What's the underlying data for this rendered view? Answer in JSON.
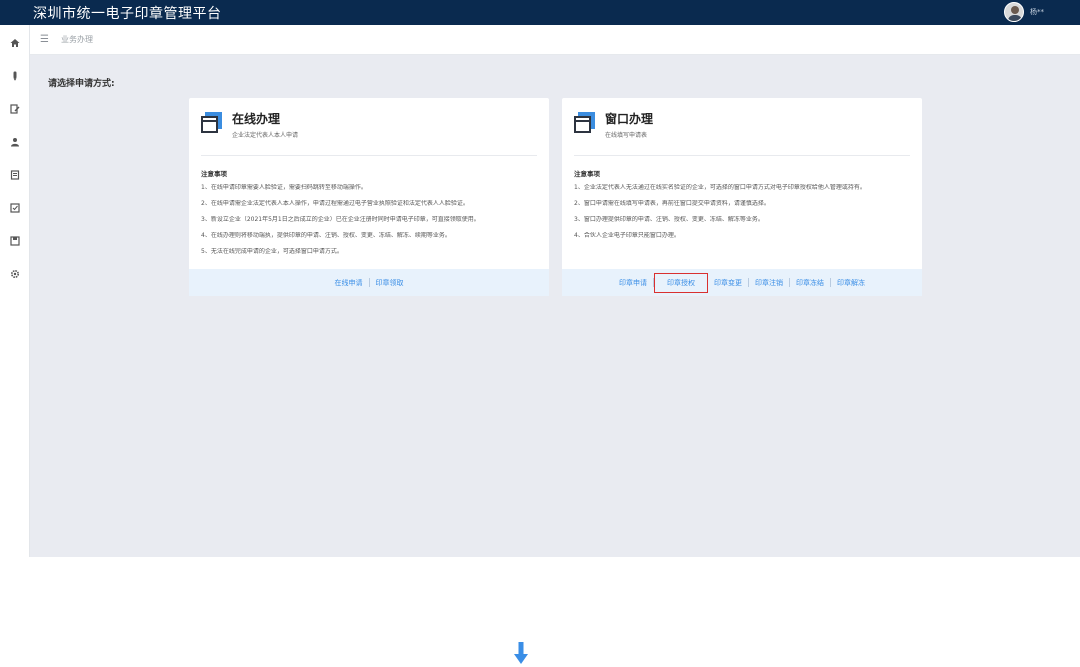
{
  "app": {
    "title": "深圳市统一电子印章管理平台",
    "user_name": "杨**"
  },
  "sidebar": {
    "icons": [
      "home-icon",
      "pen-icon",
      "edit-icon",
      "user-icon",
      "book-icon",
      "checklist-icon",
      "save-icon",
      "gear-icon"
    ]
  },
  "breadcrumb": {
    "toggle": "☰",
    "current": "业务办理"
  },
  "page": {
    "choose_label": "请选择申请方式:"
  },
  "online": {
    "title": "在线办理",
    "subtitle": "企业法定代表人本人申请",
    "notes_title": "注意事项",
    "notes": [
      "1、在线申请印章需要人脸验证，需要扫码跳转至移动端操作。",
      "2、在线申请需企业法定代表人本人操作，申请过程需通过电子营业执照验证和法定代表人人脸验证。",
      "3、新设立企业（2021年5月1日之后成立的企业）已在企业注册时同时申请电子印章，可直接领取使用。",
      "4、在线办理则将移动端执，提供印章的申请、注销、授权、变更、冻结、解冻、续期等业务。",
      "5、无法在线完成申请的企业，可选择窗口申请方式。"
    ],
    "links": [
      "在线申请",
      "印章领取"
    ]
  },
  "window": {
    "title": "窗口办理",
    "subtitle": "在线填写申请表",
    "notes_title": "注意事项",
    "notes": [
      "1、企业法定代表人无法通过在线实名验证的企业，可选择的窗口申请方式对电子印章授权给他人管理或持有。",
      "2、窗口申请需在线填写申请表，再前往窗口提交申请资料，请谨慎选择。",
      "3、窗口办理提供印章的申请、注销、授权、变更、冻结、解冻等业务。",
      "4、合伙人企业电子印章只能窗口办理。"
    ],
    "links": [
      "印章申请",
      "印章授权",
      "印章变更",
      "印章注销",
      "印章冻结",
      "印章解冻"
    ],
    "highlighted_link": "印章授权"
  },
  "colors": {
    "topbar": "#0a2a4f",
    "accent": "#3a8ee6",
    "highlight_border": "#d93030",
    "arrow": "#3a8ee6"
  }
}
